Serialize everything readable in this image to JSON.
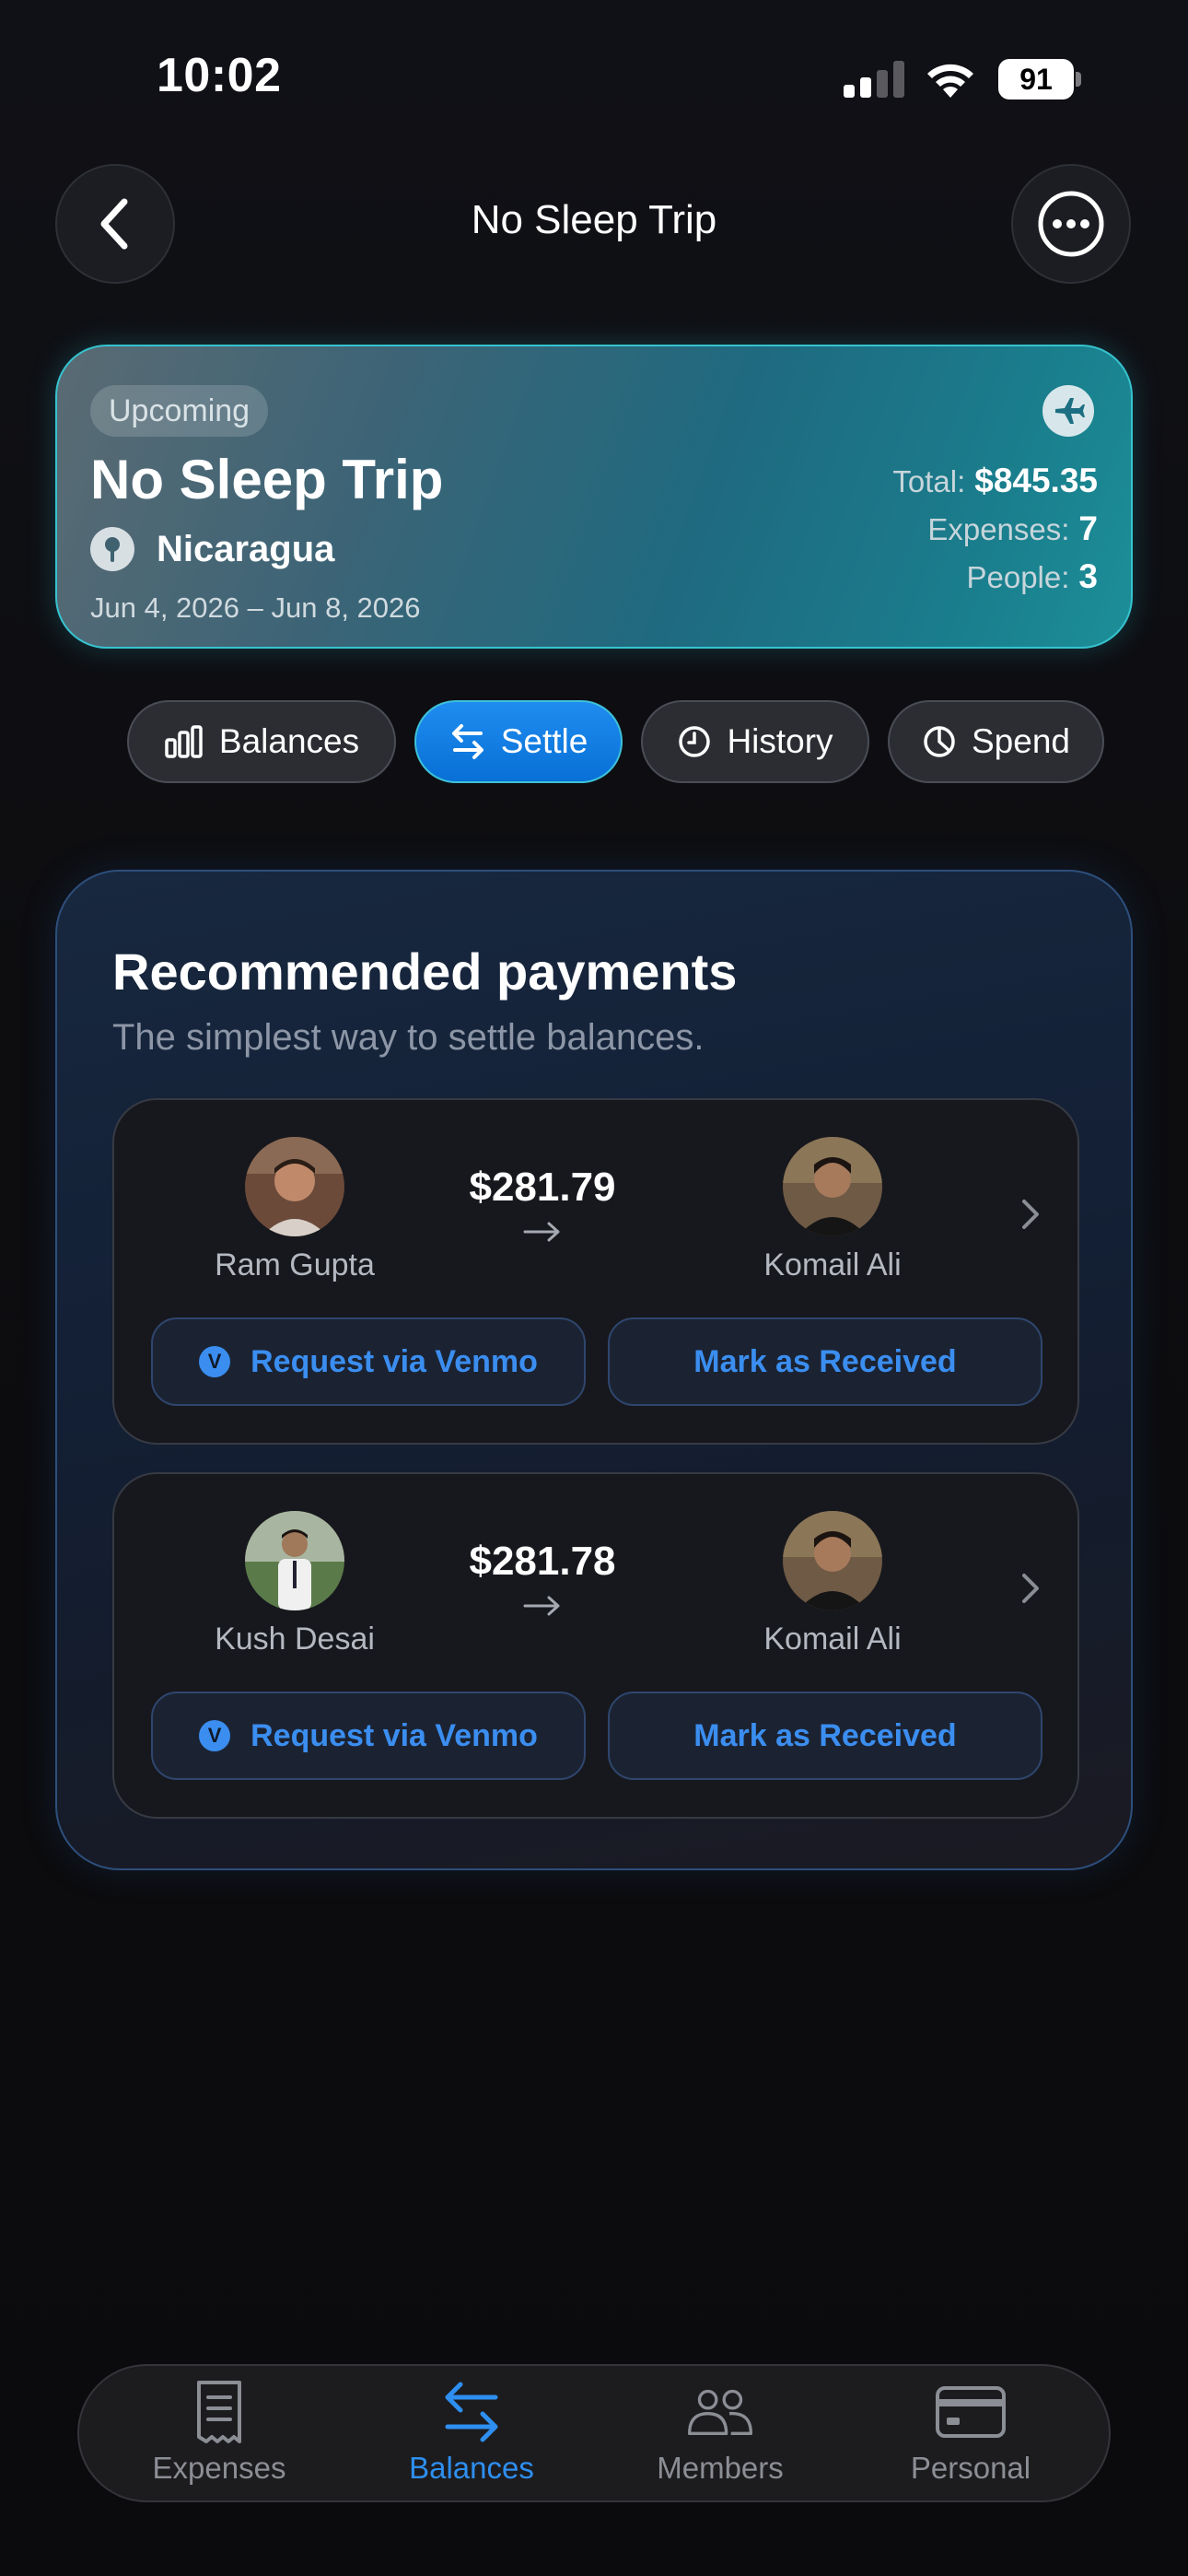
{
  "status_bar": {
    "time": "10:02",
    "battery": "91"
  },
  "nav": {
    "title": "No Sleep Trip",
    "back_icon": "chevron-left-icon",
    "more_icon": "ellipsis-circle-icon"
  },
  "trip": {
    "badge": "Upcoming",
    "title": "No Sleep Trip",
    "location": "Nicaragua",
    "dates": "Jun 4, 2026 – Jun 8, 2026",
    "stats": [
      {
        "label": "Total:",
        "value": "$845.35"
      },
      {
        "label": "Expenses:",
        "value": "7"
      },
      {
        "label": "People:",
        "value": "3"
      }
    ]
  },
  "tabs": [
    {
      "label": "Balances",
      "icon": "bar-chart-icon",
      "active": false
    },
    {
      "label": "Settle",
      "icon": "arrows-exchange-icon",
      "active": true
    },
    {
      "label": "History",
      "icon": "clock-icon",
      "active": false
    },
    {
      "label": "Spend",
      "icon": "pie-chart-icon",
      "active": false
    }
  ],
  "payments": {
    "title": "Recommended payments",
    "subtitle": "The simplest way to settle balances.",
    "items": [
      {
        "from": "Ram Gupta",
        "to": "Komail Ali",
        "amount": "$281.79",
        "venmo_label": "Request via Venmo",
        "received_label": "Mark as Received"
      },
      {
        "from": "Kush Desai",
        "to": "Komail Ali",
        "amount": "$281.78",
        "venmo_label": "Request via Venmo",
        "received_label": "Mark as Received"
      }
    ]
  },
  "tab_bar": {
    "items": [
      {
        "label": "Expenses",
        "icon": "receipt-icon",
        "active": false
      },
      {
        "label": "Balances",
        "icon": "arrows-exchange-icon",
        "active": true
      },
      {
        "label": "Members",
        "icon": "people-icon",
        "active": false
      },
      {
        "label": "Personal",
        "icon": "card-icon",
        "active": false
      }
    ]
  },
  "colors": {
    "accent": "#2e8ff0",
    "background": "#0d0d10",
    "trip_card_border": "#36c3cf"
  }
}
